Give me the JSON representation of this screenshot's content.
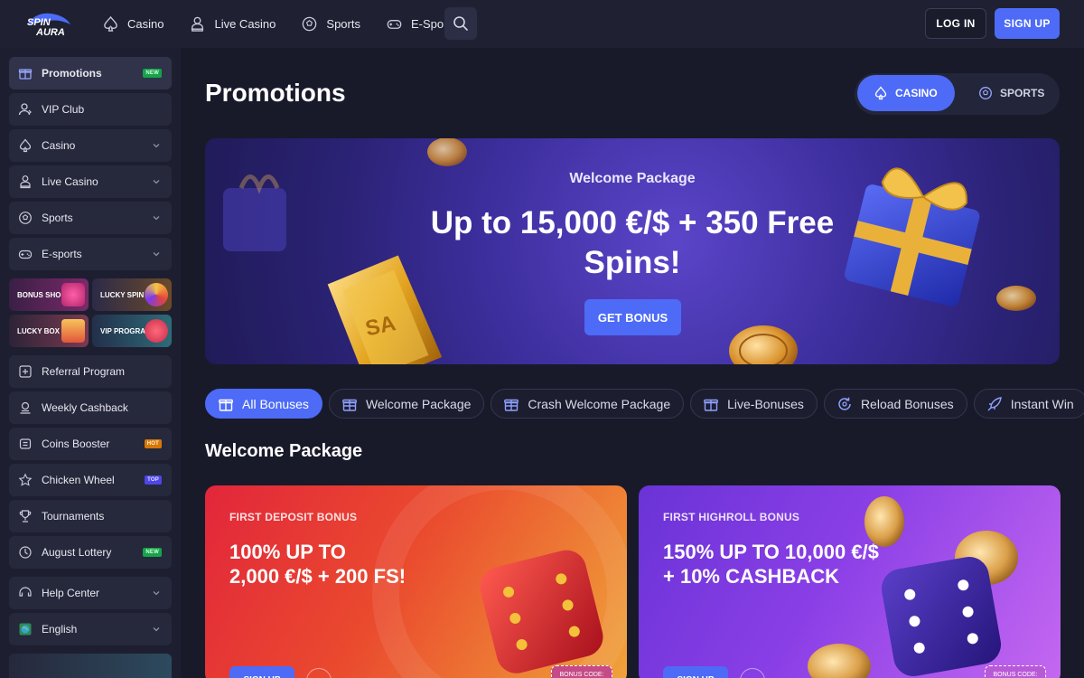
{
  "header": {
    "logo_text": "SPIN AURA",
    "nav": [
      {
        "label": "Casino",
        "icon": "spade-icon"
      },
      {
        "label": "Live Casino",
        "icon": "dealer-icon"
      },
      {
        "label": "Sports",
        "icon": "soccer-ball-icon"
      },
      {
        "label": "E-Sports",
        "icon": "gamepad-icon"
      }
    ],
    "login_label": "LOG IN",
    "signup_label": "SIGN UP"
  },
  "sidebar": {
    "items": [
      {
        "label": "Promotions",
        "icon": "gift-icon",
        "badge": "NEW"
      },
      {
        "label": "VIP Club",
        "icon": "vip-user-icon"
      },
      {
        "label": "Casino",
        "icon": "spade-icon"
      },
      {
        "label": "Live Casino",
        "icon": "dealer-icon"
      },
      {
        "label": "Sports",
        "icon": "soccer-ball-icon"
      },
      {
        "label": "E-sports",
        "icon": "gamepad-icon"
      }
    ],
    "tiles": [
      {
        "label": "BONUS SHOP"
      },
      {
        "label": "LUCKY SPIN"
      },
      {
        "label": "LUCKY BOX"
      },
      {
        "label": "VIP PROGRAM"
      }
    ],
    "items2": [
      {
        "label": "Referral Program",
        "icon": "referral-icon"
      },
      {
        "label": "Weekly Cashback",
        "icon": "cashback-icon"
      },
      {
        "label": "Coins Booster",
        "icon": "coins-icon",
        "badge": "HOT"
      },
      {
        "label": "Chicken Wheel",
        "icon": "star-icon",
        "badge": "TOP"
      },
      {
        "label": "Tournaments",
        "icon": "trophy-icon"
      },
      {
        "label": "August Lottery",
        "icon": "ticket-icon",
        "badge": "NEW"
      },
      {
        "label": "Help Center",
        "icon": "help-icon"
      },
      {
        "label": "English",
        "icon": "globe-icon"
      }
    ]
  },
  "main": {
    "title": "Promotions",
    "toggle": {
      "casino": "CASINO",
      "sports": "SPORTS"
    },
    "hero": {
      "subtitle": "Welcome Package",
      "title": "Up to 15,000 €/$ + 350 Free Spins!",
      "button": "GET BONUS"
    },
    "filters": [
      {
        "label": "All Bonuses"
      },
      {
        "label": "Welcome Package"
      },
      {
        "label": "Crash Welcome Package"
      },
      {
        "label": "Live-Bonuses"
      },
      {
        "label": "Reload Bonuses"
      },
      {
        "label": "Instant Win"
      }
    ],
    "section_title": "Welcome Package",
    "cards": [
      {
        "kicker": "FIRST DEPOSIT BONUS",
        "line1": "100% UP TO",
        "line2": "2,000 €/$ + 200 FS!",
        "button": "SIGN UP",
        "code_label": "BONUS CODE:"
      },
      {
        "kicker": "FIRST HIGHROLL BONUS",
        "line1": "150% UP TO 10,000 €/$",
        "line2": "+ 10% CASHBACK",
        "button": "SIGN UP",
        "code_label": "BONUS CODE:"
      }
    ]
  },
  "colors": {
    "accent": "#4d6bf7",
    "bg": "#181a2a",
    "sidebar": "#1d1f30"
  }
}
